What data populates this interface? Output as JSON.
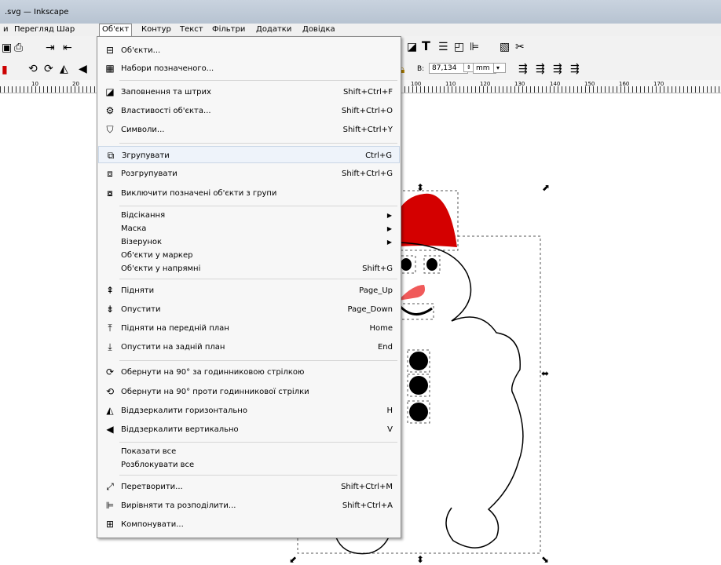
{
  "window": {
    "title": ".svg — Inkscape"
  },
  "menubar": {
    "items": [
      "и",
      "Перегляд",
      "Шар",
      "Об'єкт",
      "Контур",
      "Текст",
      "Фільтри",
      "Додатки",
      "Довідка"
    ]
  },
  "toolbar": {
    "w_label": "В:",
    "w_value": "87,134",
    "unit": "mm"
  },
  "ruler": {
    "labels": [
      "10",
      "20",
      "100",
      "110",
      "120",
      "130",
      "140",
      "150",
      "160",
      "170"
    ]
  },
  "menu": {
    "items": [
      {
        "label": "Об'єкти...",
        "shortcut": "",
        "icon": "objects-icon"
      },
      {
        "label": "Набори позначеного...",
        "shortcut": "",
        "icon": "selection-sets-icon"
      },
      {
        "label": "Заповнення та штрих",
        "shortcut": "Shift+Ctrl+F",
        "icon": "fill-stroke-icon"
      },
      {
        "label": "Властивості об'єкта...",
        "shortcut": "Shift+Ctrl+O",
        "icon": "object-properties-icon"
      },
      {
        "label": "Символи...",
        "shortcut": "Shift+Ctrl+Y",
        "icon": "symbols-icon"
      },
      {
        "label": "Згрупувати",
        "shortcut": "Ctrl+G",
        "icon": "group-icon"
      },
      {
        "label": "Розгрупувати",
        "shortcut": "Shift+Ctrl+G",
        "icon": "ungroup-icon"
      },
      {
        "label": "Виключити позначені об'єкти з групи",
        "shortcut": "",
        "icon": "pop-from-group-icon"
      },
      {
        "label": "Відсікання",
        "submenu": true
      },
      {
        "label": "Маска",
        "submenu": true
      },
      {
        "label": "Візерунок",
        "submenu": true
      },
      {
        "label": "Об'єкти у маркер",
        "shortcut": ""
      },
      {
        "label": "Об'єкти у напрямні",
        "shortcut": "Shift+G"
      },
      {
        "label": "Підняти",
        "shortcut": "Page_Up",
        "icon": "raise-icon"
      },
      {
        "label": "Опустити",
        "shortcut": "Page_Down",
        "icon": "lower-icon"
      },
      {
        "label": "Підняти на передній план",
        "shortcut": "Home",
        "icon": "raise-to-top-icon"
      },
      {
        "label": "Опустити на задній план",
        "shortcut": "End",
        "icon": "lower-to-bottom-icon"
      },
      {
        "label": "Обернути на 90° за годинниковою стрілкою",
        "shortcut": "",
        "icon": "rotate-cw-icon"
      },
      {
        "label": "Обернути на 90° проти годинникової стрілки",
        "shortcut": "",
        "icon": "rotate-ccw-icon"
      },
      {
        "label": "Віддзеркалити горизонтально",
        "shortcut": "H",
        "icon": "flip-horizontal-icon"
      },
      {
        "label": "Віддзеркалити вертикально",
        "shortcut": "V",
        "icon": "flip-vertical-icon"
      },
      {
        "label": "Показати все",
        "shortcut": ""
      },
      {
        "label": "Розблокувати все",
        "shortcut": ""
      },
      {
        "label": "Перетворити...",
        "shortcut": "Shift+Ctrl+M",
        "icon": "transform-icon"
      },
      {
        "label": "Вирівняти та розподілити...",
        "shortcut": "Shift+Ctrl+A",
        "icon": "align-distribute-icon"
      },
      {
        "label": "Компонувати...",
        "shortcut": "",
        "icon": "arrange-icon"
      }
    ]
  },
  "colors": {
    "hat": "#d40000",
    "nose": "#f05a5a",
    "menu_bg": "#f7f7f7",
    "title_bg": "#c3cedb"
  }
}
